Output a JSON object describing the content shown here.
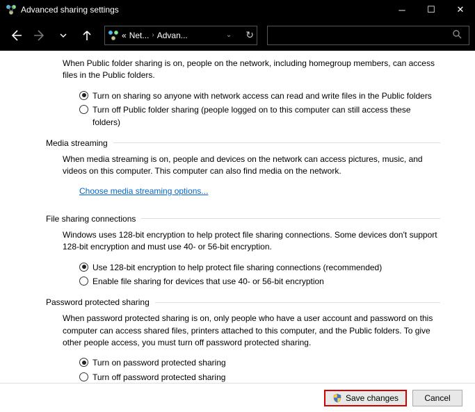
{
  "window": {
    "title": "Advanced sharing settings"
  },
  "breadcrumb": {
    "prefix": "«",
    "item1": "Net...",
    "item2": "Advan..."
  },
  "public_folder": {
    "desc": "When Public folder sharing is on, people on the network, including homegroup members, can access files in the Public folders.",
    "opt_on": "Turn on sharing so anyone with network access can read and write files in the Public folders",
    "opt_off": "Turn off Public folder sharing (people logged on to this computer can still access these folders)"
  },
  "media": {
    "header": "Media streaming",
    "desc": "When media streaming is on, people and devices on the network can access pictures, music, and videos on this computer. This computer can also find media on the network.",
    "link": "Choose media streaming options..."
  },
  "file_sharing": {
    "header": "File sharing connections",
    "desc": "Windows uses 128-bit encryption to help protect file sharing connections. Some devices don't support 128-bit encryption and must use 40- or 56-bit encryption.",
    "opt_128": "Use 128-bit encryption to help protect file sharing connections (recommended)",
    "opt_40": "Enable file sharing for devices that use 40- or 56-bit encryption"
  },
  "password": {
    "header": "Password protected sharing",
    "desc": "When password protected sharing is on, only people who have a user account and password on this computer can access shared files, printers attached to this computer, and the Public folders. To give other people access, you must turn off password protected sharing.",
    "opt_on": "Turn on password protected sharing",
    "opt_off": "Turn off password protected sharing"
  },
  "footer": {
    "save": "Save changes",
    "cancel": "Cancel"
  }
}
